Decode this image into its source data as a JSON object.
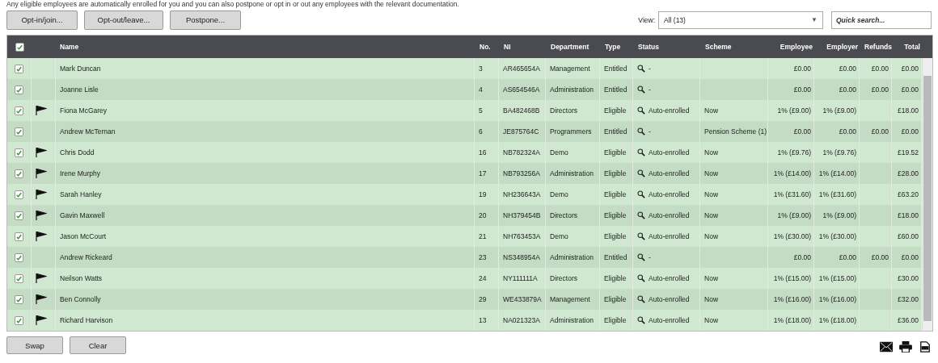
{
  "intro": "Any eligible employees are automatically enrolled for you and you can also postpone or opt in or out any employees with the relevant documentation.",
  "actions": [
    "Opt-in/join...",
    "Opt-out/leave...",
    "Postpone..."
  ],
  "view": {
    "label": "View:",
    "value": "All (13)",
    "caret": "▼"
  },
  "search": {
    "placeholder": "Quick search..."
  },
  "table": {
    "select_all": true,
    "columns": [
      "Name",
      "No.",
      "NI",
      "Department",
      "Type",
      "Status",
      "Scheme",
      "Employee",
      "Employer",
      "Refunds",
      "Total"
    ],
    "rows": [
      {
        "checked": true,
        "flagged": false,
        "name": "Mark Duncan",
        "no": "3",
        "ni": "AR465654A",
        "department": "Management",
        "type": "Entitled",
        "status": "-",
        "scheme": "",
        "employee": "£0.00",
        "employer": "£0.00",
        "refunds": "£0.00",
        "total": "£0.00"
      },
      {
        "checked": true,
        "flagged": false,
        "name": "Joanne Lisle",
        "no": "4",
        "ni": "AS654546A",
        "department": "Administration",
        "type": "Entitled",
        "status": "-",
        "scheme": "",
        "employee": "£0.00",
        "employer": "£0.00",
        "refunds": "£0.00",
        "total": "£0.00"
      },
      {
        "checked": true,
        "flagged": true,
        "name": "Fiona McGarey",
        "no": "5",
        "ni": "BA482468B",
        "department": "Directors",
        "type": "Eligible",
        "status": "Auto-enrolled",
        "scheme": "Now",
        "employee": "1% (£9.00)",
        "employer": "1% (£9.00)",
        "refunds": "",
        "total": "£18.00"
      },
      {
        "checked": true,
        "flagged": false,
        "name": "Andrew McTernan",
        "no": "6",
        "ni": "JE875764C",
        "department": "Programmers",
        "type": "Entitled",
        "status": "-",
        "scheme": "Pension Scheme (1)",
        "employee": "£0.00",
        "employer": "£0.00",
        "refunds": "£0.00",
        "total": "£0.00"
      },
      {
        "checked": true,
        "flagged": true,
        "name": "Chris Dodd",
        "no": "16",
        "ni": "NB782324A",
        "department": "Demo",
        "type": "Eligible",
        "status": "Auto-enrolled",
        "scheme": "Now",
        "employee": "1% (£9.76)",
        "employer": "1% (£9.76)",
        "refunds": "",
        "total": "£19.52"
      },
      {
        "checked": true,
        "flagged": true,
        "name": "Irene Murphy",
        "no": "17",
        "ni": "NB793256A",
        "department": "Administration",
        "type": "Eligible",
        "status": "Auto-enrolled",
        "scheme": "Now",
        "employee": "1% (£14.00)",
        "employer": "1% (£14.00)",
        "refunds": "",
        "total": "£28.00"
      },
      {
        "checked": true,
        "flagged": true,
        "name": "Sarah Hanley",
        "no": "19",
        "ni": "NH236643A",
        "department": "Demo",
        "type": "Eligible",
        "status": "Auto-enrolled",
        "scheme": "Now",
        "employee": "1% (£31.60)",
        "employer": "1% (£31.60)",
        "refunds": "",
        "total": "£63.20"
      },
      {
        "checked": true,
        "flagged": true,
        "name": "Gavin Maxwell",
        "no": "20",
        "ni": "NH379454B",
        "department": "Directors",
        "type": "Eligible",
        "status": "Auto-enrolled",
        "scheme": "Now",
        "employee": "1% (£9.00)",
        "employer": "1% (£9.00)",
        "refunds": "",
        "total": "£18.00"
      },
      {
        "checked": true,
        "flagged": true,
        "name": "Jason McCourt",
        "no": "21",
        "ni": "NH763453A",
        "department": "Demo",
        "type": "Eligible",
        "status": "Auto-enrolled",
        "scheme": "Now",
        "employee": "1% (£30.00)",
        "employer": "1% (£30.00)",
        "refunds": "",
        "total": "£60.00"
      },
      {
        "checked": true,
        "flagged": false,
        "name": "Andrew Rickeard",
        "no": "23",
        "ni": "NS348954A",
        "department": "Administration",
        "type": "Entitled",
        "status": "-",
        "scheme": "",
        "employee": "£0.00",
        "employer": "£0.00",
        "refunds": "£0.00",
        "total": "£0.00"
      },
      {
        "checked": true,
        "flagged": true,
        "name": "Neilson Watts",
        "no": "24",
        "ni": "NY111111A",
        "department": "Directors",
        "type": "Eligible",
        "status": "Auto-enrolled",
        "scheme": "Now",
        "employee": "1% (£15.00)",
        "employer": "1% (£15.00)",
        "refunds": "",
        "total": "£30.00"
      },
      {
        "checked": true,
        "flagged": true,
        "name": "Ben Connolly",
        "no": "29",
        "ni": "WE433879A",
        "department": "Management",
        "type": "Eligible",
        "status": "Auto-enrolled",
        "scheme": "Now",
        "employee": "1% (£16.00)",
        "employer": "1% (£16.00)",
        "refunds": "",
        "total": "£32.00"
      },
      {
        "checked": true,
        "flagged": true,
        "name": "Richard Harvison",
        "no": "13",
        "ni": "NA021323A",
        "department": "Administration",
        "type": "Eligible",
        "status": "Auto-enrolled",
        "scheme": "Now",
        "employee": "1% (£18.00)",
        "employer": "1% (£18.00)",
        "refunds": "",
        "total": "£36.00"
      }
    ]
  },
  "footer_buttons": [
    "Swap",
    "Clear"
  ]
}
